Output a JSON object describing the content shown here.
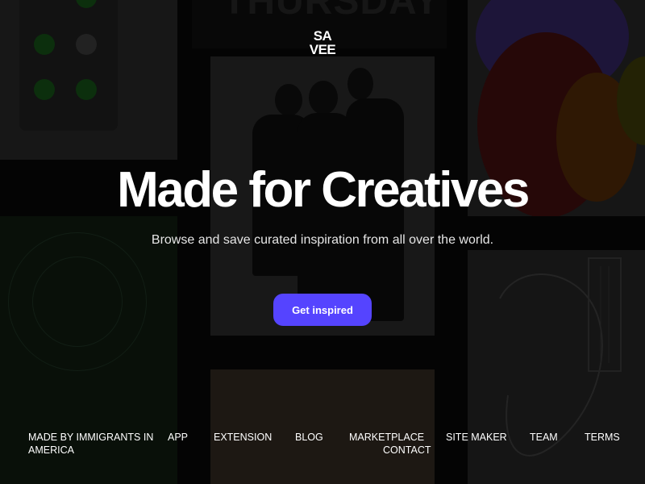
{
  "brand": {
    "logo_line1": "SA",
    "logo_line2": "VEE"
  },
  "hero": {
    "headline": "Made for Creatives",
    "subtitle": "Browse and save curated inspiration from all over the world.",
    "cta_label": "Get inspired"
  },
  "background": {
    "poster_text": "THURSDAY"
  },
  "footer": {
    "items": [
      {
        "label": "MADE BY IMMIGRANTS IN AMERICA"
      },
      {
        "label": "APP"
      },
      {
        "label": "EXTENSION"
      },
      {
        "label": "BLOG"
      },
      {
        "label": "MARKETPLACE"
      },
      {
        "label": "SITE MAKER"
      },
      {
        "label": "TEAM"
      },
      {
        "label": "TERMS"
      },
      {
        "label": "CONTACT"
      }
    ]
  },
  "colors": {
    "background": "#050505",
    "accent": "#5544ff",
    "text": "#ffffff"
  }
}
